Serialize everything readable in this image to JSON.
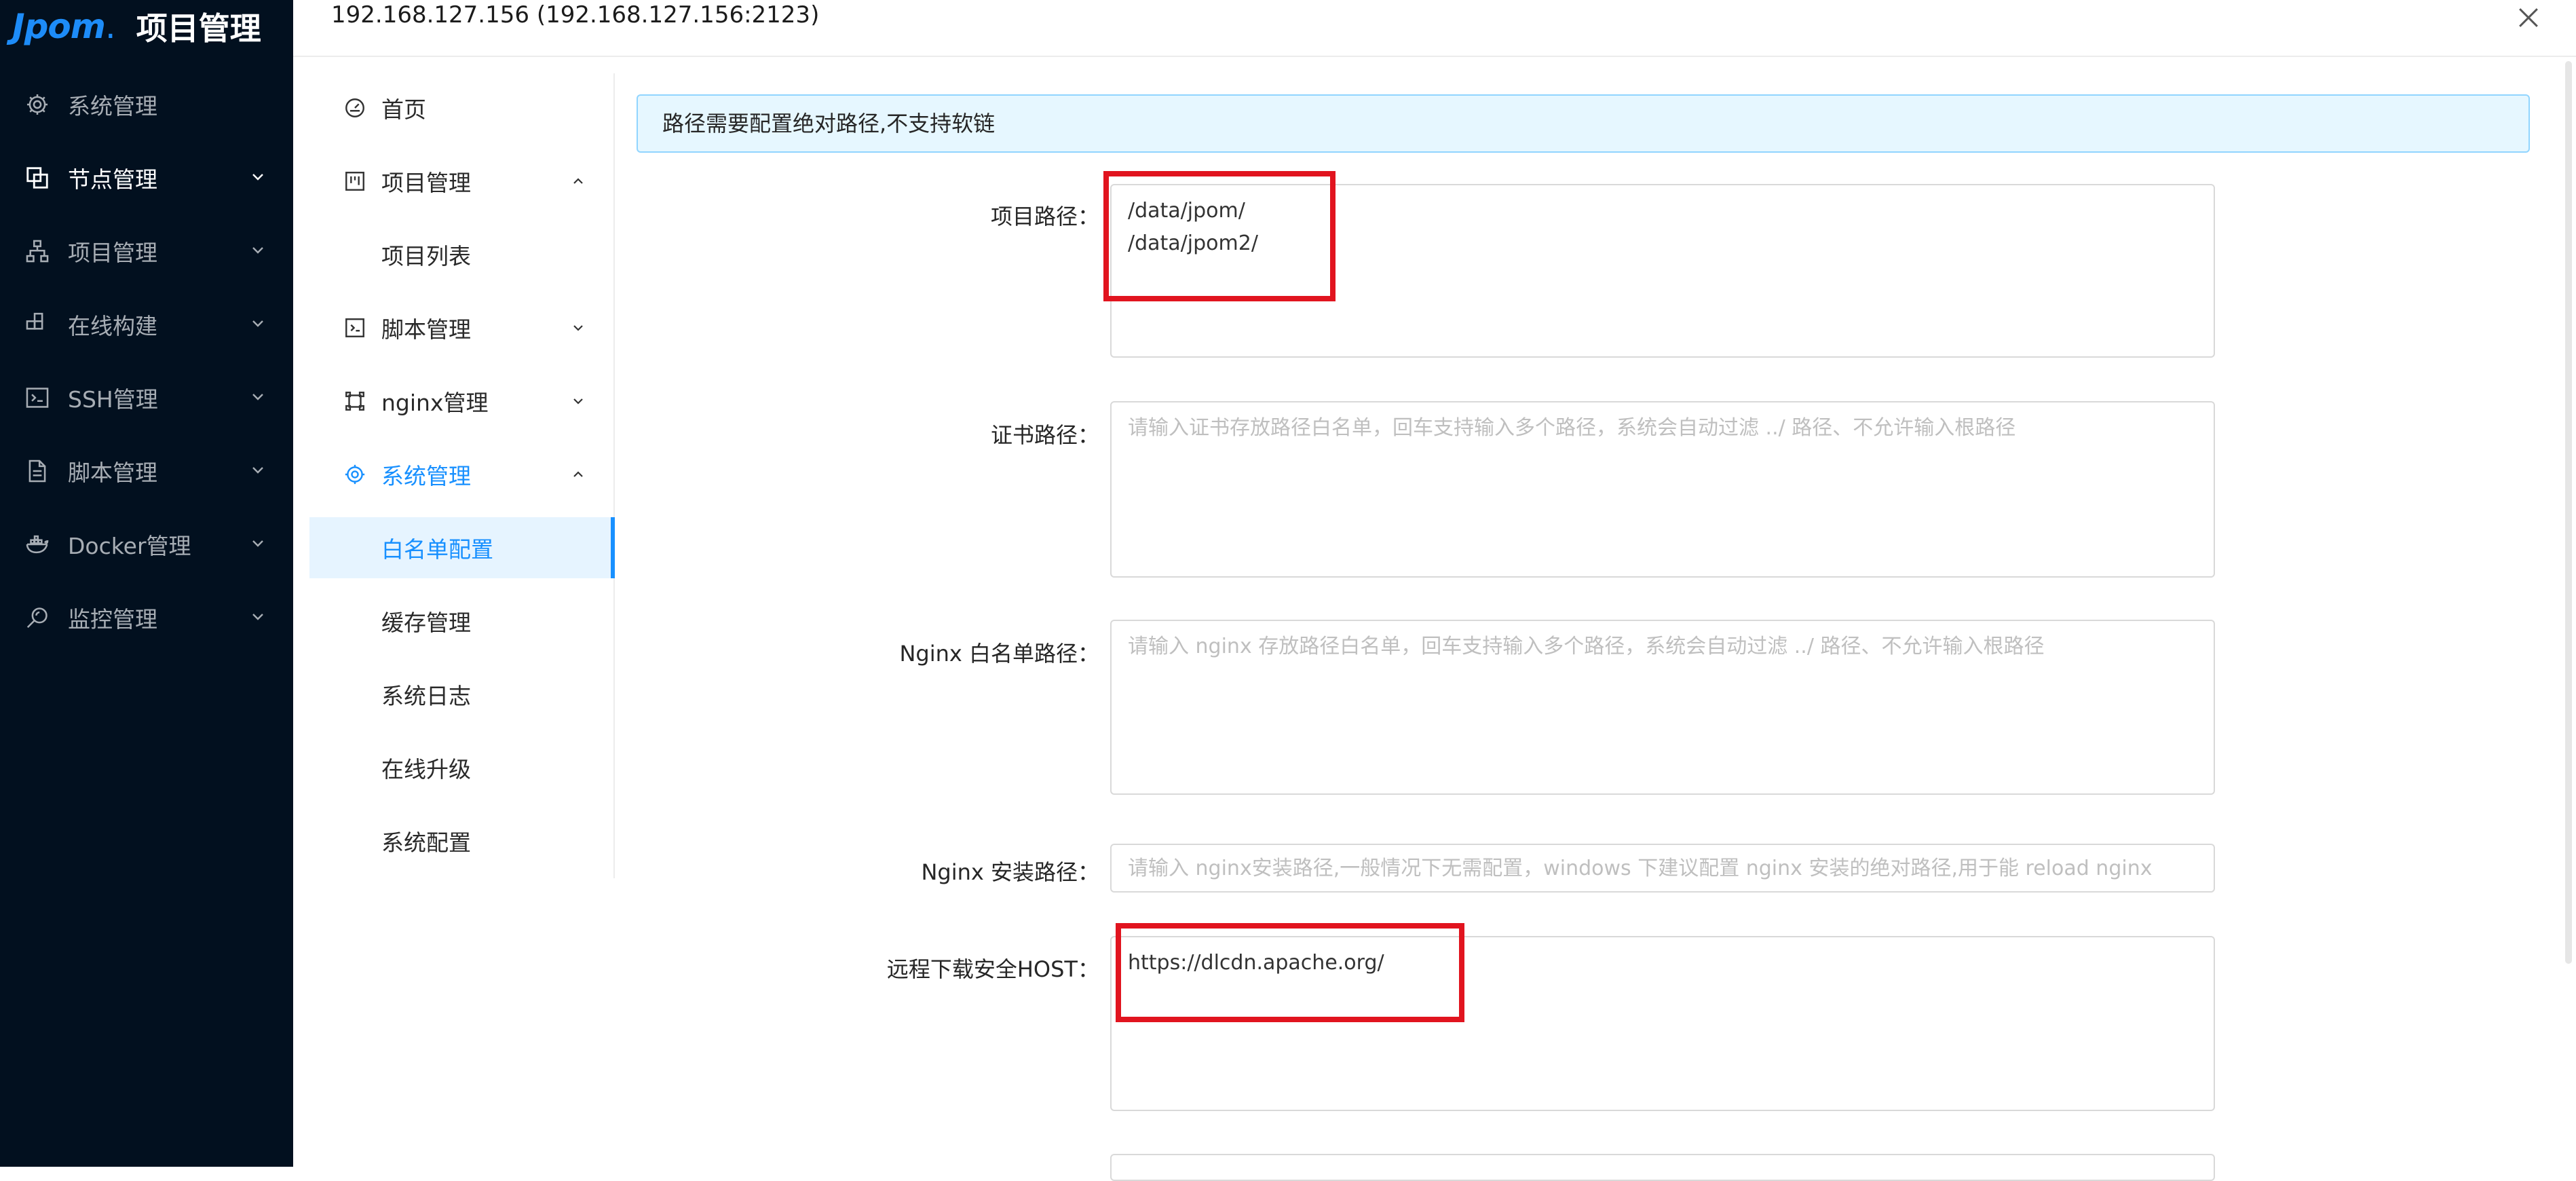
{
  "app": {
    "logo_text": "Jpom",
    "logo_dot": ".",
    "title": "项目管理"
  },
  "sidebar": {
    "items": [
      {
        "label": "系统管理",
        "icon": "gear-icon"
      },
      {
        "label": "节点管理",
        "icon": "node-icon"
      },
      {
        "label": "项目管理",
        "icon": "project-tree-icon"
      },
      {
        "label": "在线构建",
        "icon": "build-icon"
      },
      {
        "label": "SSH管理",
        "icon": "terminal-icon"
      },
      {
        "label": "脚本管理",
        "icon": "file-icon"
      },
      {
        "label": "Docker管理",
        "icon": "docker-icon"
      },
      {
        "label": "监控管理",
        "icon": "monitor-icon"
      }
    ]
  },
  "modal": {
    "title": "192.168.127.156 (192.168.127.156:2123)"
  },
  "inner_menu": {
    "items": [
      {
        "label": "首页",
        "icon": "dashboard-icon"
      },
      {
        "label": "项目管理",
        "icon": "project-icon"
      },
      {
        "label": "项目列表"
      },
      {
        "label": "脚本管理",
        "icon": "script-icon"
      },
      {
        "label": "nginx管理",
        "icon": "nginx-icon"
      },
      {
        "label": "系统管理",
        "icon": "gear-icon"
      },
      {
        "label": "白名单配置"
      },
      {
        "label": "缓存管理"
      },
      {
        "label": "系统日志"
      },
      {
        "label": "在线升级"
      },
      {
        "label": "系统配置"
      }
    ]
  },
  "alert": {
    "message": "路径需要配置绝对路径,不支持软链"
  },
  "form": {
    "project_path": {
      "label": "项目路径",
      "value": "/data/jpom/\n/data/jpom2/"
    },
    "cert_path": {
      "label": "证书路径",
      "placeholder": "请输入证书存放路径白名单，回车支持输入多个路径，系统会自动过滤 ../ 路径、不允许输入根路径"
    },
    "nginx_whitelist": {
      "label": "Nginx 白名单路径",
      "placeholder": "请输入 nginx 存放路径白名单，回车支持输入多个路径，系统会自动过滤 ../ 路径、不允许输入根路径"
    },
    "nginx_install": {
      "label": "Nginx 安装路径",
      "placeholder": "请输入 nginx安装路径,一般情况下无需配置，windows 下建议配置 nginx 安装的绝对路径,用于能 reload nginx"
    },
    "remote_host": {
      "label": "远程下载安全HOST",
      "value": "https://dlcdn.apache.org/"
    }
  }
}
